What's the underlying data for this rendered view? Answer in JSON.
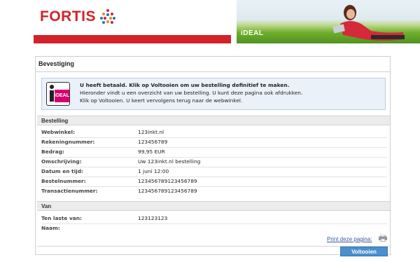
{
  "brand": {
    "name": "FORTIS",
    "color": "#d2232a",
    "banner_label": "iDEAL"
  },
  "panel": {
    "title": "Bevestiging"
  },
  "notice": {
    "logo_text": "iDEAL",
    "line1": "U heeft betaald. Klik op Voltooien om uw bestelling definitief te maken.",
    "line2": "Hieronder vindt u een overzicht van uw bestelling. U kunt deze pagina ook afdrukken.",
    "line3": "Klik op Voltooien. U keert vervolgens terug naar de webwinkel."
  },
  "bestelling": {
    "heading": "Bestelling",
    "rows": [
      {
        "label": "Webwinkel:",
        "value": "123inkt.nl"
      },
      {
        "label": "Rekeningnummer:",
        "value": "123456789"
      },
      {
        "label": "Bedrag:",
        "value": "99,95 EUR"
      },
      {
        "label": "Omschrijving:",
        "value": " Uw 123inkt.nl bestelling"
      },
      {
        "label": "Datum en tijd:",
        "value": "1 juni 12:00"
      },
      {
        "label": "Bestelnummer:",
        "value": "123456789123456789"
      },
      {
        "label": "Transactienummer:",
        "value": "123456789123456789"
      }
    ]
  },
  "van": {
    "heading": "Van",
    "rows": [
      {
        "label": "Ten laste van:",
        "value": "123123123"
      },
      {
        "label": "Naam:",
        "value": ""
      }
    ]
  },
  "actions": {
    "print_label": "Print deze pagina:",
    "submit_label": "Voltooien",
    "accent": "#4a8fce"
  }
}
